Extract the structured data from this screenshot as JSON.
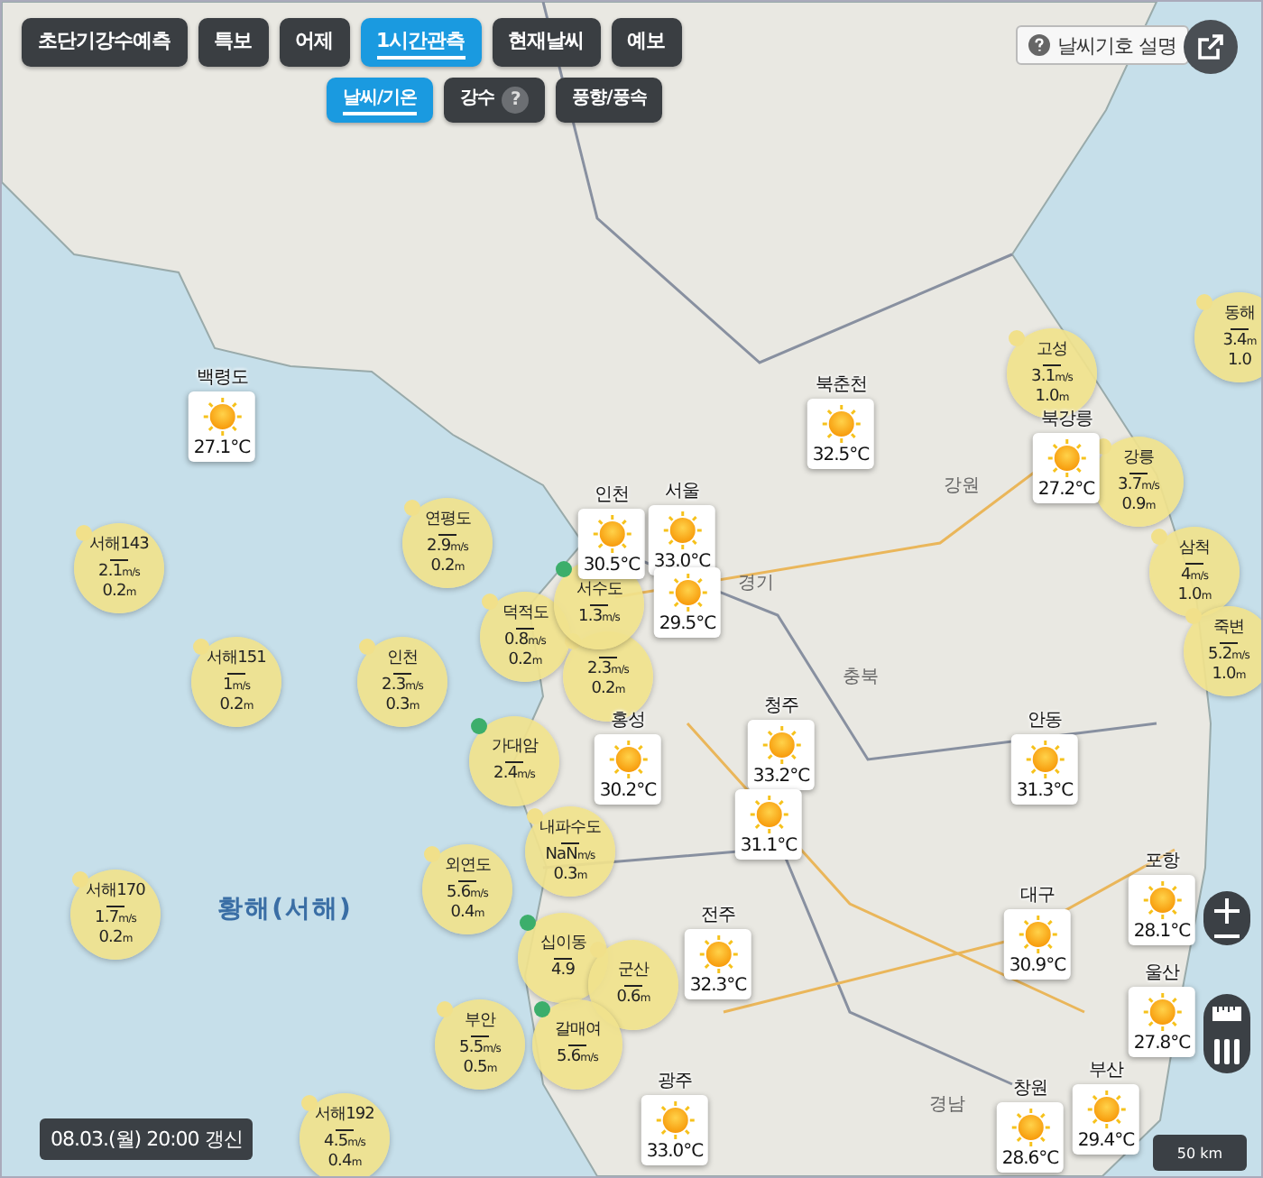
{
  "tabs": [
    {
      "label": "초단기강수예측",
      "selected": false
    },
    {
      "label": "특보",
      "selected": false
    },
    {
      "label": "어제",
      "selected": false
    },
    {
      "label": "1시간관측",
      "selected": true
    },
    {
      "label": "현재날씨",
      "selected": false
    },
    {
      "label": "예보",
      "selected": false
    }
  ],
  "subtabs": [
    {
      "label": "날씨/기온",
      "selected": true
    },
    {
      "label": "강수",
      "selected": false,
      "help": "?"
    },
    {
      "label": "풍향/풍속",
      "selected": false
    }
  ],
  "legend_button": {
    "label": "날씨기호 설명"
  },
  "regions": [
    {
      "label": "강원",
      "kind": "province"
    },
    {
      "label": "경기",
      "kind": "province"
    },
    {
      "label": "충북",
      "kind": "province"
    },
    {
      "label": "경남",
      "kind": "province"
    },
    {
      "label": "황해(서해)",
      "kind": "sea"
    }
  ],
  "buoys": [
    {
      "name": "서해143",
      "wind": "2.1",
      "wind_unit": "m/s",
      "wave": "0.2",
      "wave_unit": "m",
      "color": "#f1e08a"
    },
    {
      "name": "연평도",
      "wind": "2.9",
      "wind_unit": "m/s",
      "wave": "0.2",
      "wave_unit": "m",
      "color": "#f1e08a"
    },
    {
      "name": "서해151",
      "wind": "1",
      "wind_unit": "m/s",
      "wave": "0.2",
      "wave_unit": "m",
      "color": "#f1e08a"
    },
    {
      "name": "인천",
      "wind": "2.3",
      "wind_unit": "m/s",
      "wave": "0.3",
      "wave_unit": "m",
      "color": "#f1e08a"
    },
    {
      "name": "덕적도",
      "wind": "0.8",
      "wind_unit": "m/s",
      "wave": "0.2",
      "wave_unit": "m",
      "color": "#f1e08a"
    },
    {
      "name": "서수도",
      "wind": "1.3",
      "wind_unit": "m/s",
      "color": "#3cae6b"
    },
    {
      "wind": "2.3",
      "wind_unit": "m/s",
      "wave": "0.2",
      "wave_unit": "m",
      "color": "#f1e08a"
    },
    {
      "name": "가대암",
      "wind": "2.4",
      "wind_unit": "m/s",
      "color": "#3cae6b"
    },
    {
      "name": "내파수도",
      "wind": "NaN",
      "wind_unit": "m/s",
      "wave": "0.3",
      "wave_unit": "m",
      "color": "#f1e08a"
    },
    {
      "name": "외연도",
      "wind": "5.6",
      "wind_unit": "m/s",
      "wave": "0.4",
      "wave_unit": "m",
      "color": "#f1e08a"
    },
    {
      "name": "서해170",
      "wind": "1.7",
      "wind_unit": "m/s",
      "wave": "0.2",
      "wave_unit": "m",
      "color": "#f1e08a"
    },
    {
      "name": "십이동",
      "wind": "4.9",
      "color": "#3cae6b"
    },
    {
      "name": "군산",
      "wave": "0.6",
      "wave_unit": "m",
      "color": "#f1e08a"
    },
    {
      "name": "부안",
      "wind": "5.5",
      "wind_unit": "m/s",
      "wave": "0.5",
      "wave_unit": "m",
      "color": "#f1e08a"
    },
    {
      "name": "갈매여",
      "wind": "5.6",
      "wind_unit": "m/s",
      "color": "#3cae6b"
    },
    {
      "name": "서해192",
      "wind": "4.5",
      "wind_unit": "m/s",
      "wave": "0.4",
      "wave_unit": "m",
      "color": "#f1e08a"
    },
    {
      "name": "고성",
      "wind": "3.1",
      "wind_unit": "m/s",
      "wave": "1.0",
      "wave_unit": "m",
      "color": "#f1e08a"
    },
    {
      "name": "동해",
      "wind": "3.4",
      "wind_unit": "m",
      "wave": "1.0",
      "color": "#f1e08a"
    },
    {
      "name": "강릉",
      "wind": "3.7",
      "wind_unit": "m/s",
      "wave": "0.9",
      "wave_unit": "m",
      "color": "#f1e08a"
    },
    {
      "name": "삼척",
      "wind": "4",
      "wind_unit": "m/s",
      "wave": "1.0",
      "wave_unit": "m",
      "color": "#f1e08a"
    },
    {
      "name": "죽변",
      "wind": "5.2",
      "wind_unit": "m/s",
      "wave": "1.0",
      "wave_unit": "m",
      "color": "#f1e08a"
    }
  ],
  "stations": [
    {
      "name": "백령도",
      "temp": "27.1°C"
    },
    {
      "name": "북춘천",
      "temp": "32.5°C"
    },
    {
      "name": "인천",
      "temp": "30.5°C"
    },
    {
      "name": "서울",
      "temp": "33.0°C"
    },
    {
      "temp": "29.5°C"
    },
    {
      "name": "북강릉",
      "temp": "27.2°C"
    },
    {
      "name": "홍성",
      "temp": "30.2°C"
    },
    {
      "name": "청주",
      "temp": "33.2°C"
    },
    {
      "temp": "31.1°C"
    },
    {
      "name": "안동",
      "temp": "31.3°C"
    },
    {
      "name": "대구",
      "temp": "30.9°C"
    },
    {
      "name": "전주",
      "temp": "32.3°C"
    },
    {
      "name": "포항",
      "temp": "28.1°C"
    },
    {
      "name": "울산",
      "temp": "27.8°C"
    },
    {
      "name": "광주",
      "temp": "33.0°C"
    },
    {
      "name": "창원",
      "temp": "28.6°C"
    },
    {
      "name": "부산",
      "temp": "29.4°C"
    }
  ],
  "updated": "08.03.(월) 20:00 갱신",
  "scale": "50 km"
}
